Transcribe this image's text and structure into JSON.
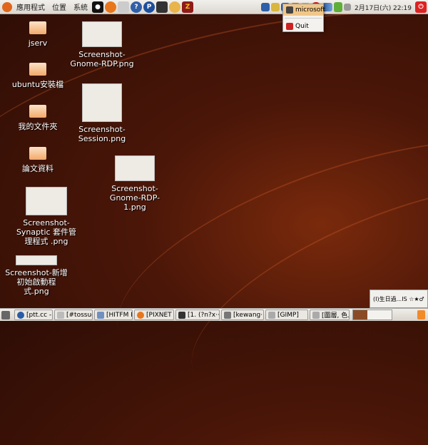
{
  "top_panel": {
    "menus": [
      "應用程式",
      "位置",
      "系統"
    ],
    "launchers": [
      "app-icon",
      "firefox-icon",
      "mail-icon",
      "help-icon",
      "pixnet-icon",
      "terminal-icon",
      "pidgin-icon",
      "filezilla-icon"
    ],
    "clock": "2月17日(六) 22:19"
  },
  "tray_menu": {
    "items": [
      {
        "label": "microsoft"
      },
      {
        "label": "Quit"
      }
    ]
  },
  "desktop": {
    "icons": [
      {
        "label": "jserv",
        "type": "folder"
      },
      {
        "label": "ubuntu安裝檔",
        "type": "folder"
      },
      {
        "label": "我的文件夾",
        "type": "folder"
      },
      {
        "label": "論文資料",
        "type": "folder"
      },
      {
        "label": "Screenshot-Synaptic 套件管理程式 .png",
        "type": "image"
      },
      {
        "label": "Screenshot-新增初始啟動程式.png",
        "type": "image"
      },
      {
        "label": "Screenshot-Gnome-RDP.png",
        "type": "image"
      },
      {
        "label": "Screenshot-Session.png",
        "type": "image"
      },
      {
        "label": "Screenshot-Gnome-RDP-1.png",
        "type": "image"
      }
    ]
  },
  "taskbar": {
    "tasks": [
      "[ptt.cc - ···",
      "[#tossug]",
      "[HITFM F···",
      "[PIXNET ...",
      "[1. (?n?x···",
      "[kewang···",
      "[GIMP]",
      "[圖層, 色..."
    ]
  },
  "notification": {
    "text": "(I)生日過...IS ☆★♂"
  }
}
